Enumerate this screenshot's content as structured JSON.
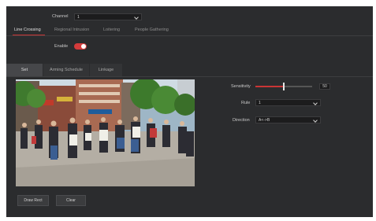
{
  "channel": {
    "label": "Channel",
    "value": "1"
  },
  "tabs": [
    "Line Crossing",
    "Regional Intrusion",
    "Loitering",
    "People Gathering"
  ],
  "active_tab": "Line Crossing",
  "enable": {
    "label": "Enable",
    "on": true
  },
  "subtabs": [
    "Set",
    "Arming Schedule",
    "Linkage"
  ],
  "active_subtab": "Set",
  "settings": {
    "sensitivity_label": "Sensitivity",
    "sensitivity_value": "50",
    "sensitivity_fraction": 0.5,
    "rule_label": "Rule",
    "rule_value": "1",
    "direction_label": "Direction",
    "direction_value": "A<->B"
  },
  "buttons": {
    "draw_rect": "Draw Rect",
    "clear": "Clear"
  },
  "colors": {
    "accent": "#d43b3b",
    "panel_bg": "#2b2c2e"
  }
}
